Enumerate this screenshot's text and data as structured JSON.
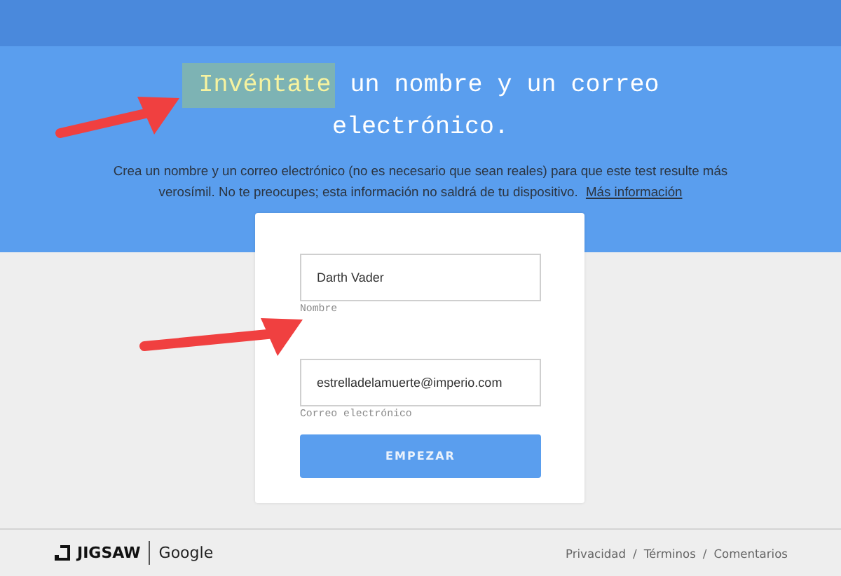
{
  "heading": {
    "highlight": "Invéntate",
    "rest": "un nombre y un correo electrónico."
  },
  "intro": {
    "text": "Crea un nombre y un correo electrónico (no es necesario que sean reales) para que este test resulte más verosímil. No te preocupes; esta información no saldrá de tu dispositivo.",
    "link": "Más información"
  },
  "form": {
    "fields": [
      {
        "value": "Darth Vader",
        "label": "Nombre"
      },
      {
        "value": "estrelladelamuerte@imperio.com",
        "label": "Correo electrónico"
      }
    ],
    "button": "EMPEZAR"
  },
  "footer": {
    "brand": "JIGSAW",
    "partner": "Google",
    "links": [
      "Privacidad",
      "Términos",
      "Comentarios"
    ],
    "separator": "/"
  },
  "annotations": [
    {
      "kind": "arrow"
    },
    {
      "kind": "arrow"
    }
  ]
}
